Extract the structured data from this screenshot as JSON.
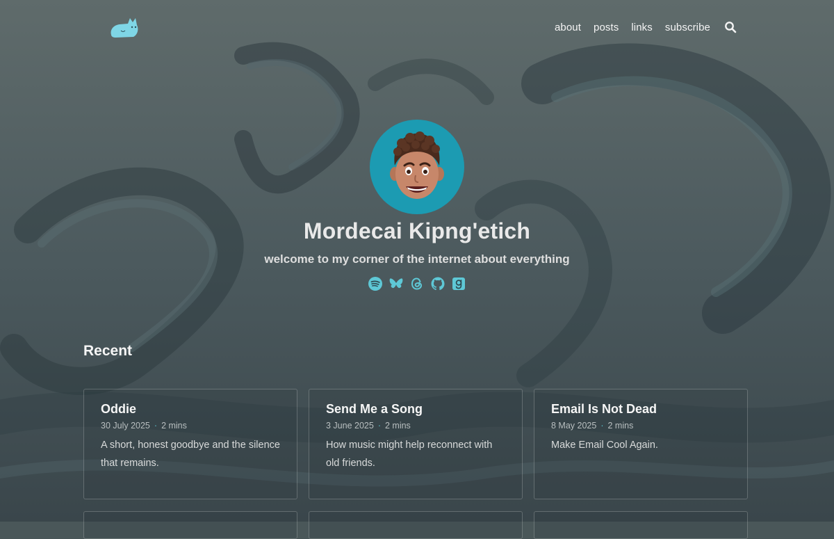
{
  "header": {
    "logo_icon": "cat-logo-icon",
    "nav": [
      {
        "label": "about"
      },
      {
        "label": "posts"
      },
      {
        "label": "links"
      },
      {
        "label": "subscribe"
      }
    ],
    "search_icon": "search-icon"
  },
  "hero": {
    "name": "Mordecai Kipng'etich",
    "tagline": "welcome to my corner of the internet about everything",
    "socials": [
      "spotify-icon",
      "bluesky-icon",
      "threads-icon",
      "github-icon",
      "goodreads-icon"
    ]
  },
  "recent": {
    "title": "Recent",
    "posts": [
      {
        "title": "Oddie",
        "date": "30 July 2025",
        "read_time": "2 mins",
        "excerpt": "A short, honest goodbye and the silence that remains."
      },
      {
        "title": "Send Me a Song",
        "date": "3 June 2025",
        "read_time": "2 mins",
        "excerpt": "How music might help reconnect with old friends."
      },
      {
        "title": "Email Is Not Dead",
        "date": "8 May 2025",
        "read_time": "2 mins",
        "excerpt": "Make Email Cool Again."
      }
    ]
  },
  "colors": {
    "accent": "#5ec8d6",
    "avatar_bg": "#1c9bb2",
    "background": "#4a5759"
  }
}
